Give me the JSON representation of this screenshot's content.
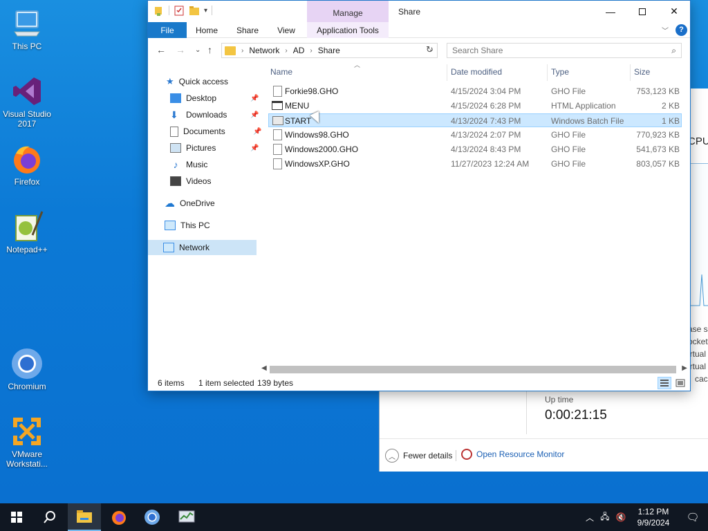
{
  "desktop": {
    "icons": [
      {
        "label": "This PC"
      },
      {
        "label": "Visual Studio 2017"
      },
      {
        "label": "Firefox"
      },
      {
        "label": "Notepad++"
      },
      {
        "label": "Chromium"
      },
      {
        "label": "VMware Workstati..."
      }
    ]
  },
  "task_manager": {
    "cpu_label": "CPU",
    "side_text": [
      "ase sp",
      "ocket",
      "irtual",
      "irtual",
      "cach"
    ],
    "uptime_label": "Up time",
    "uptime_value": "0:00:21:15",
    "fewer_details": "Fewer details",
    "open_resource_monitor": "Open Resource Monitor"
  },
  "explorer": {
    "contextual_tab": "Manage",
    "title": "Share",
    "ribbon_tabs": [
      "File",
      "Home",
      "Share",
      "View",
      "Application Tools"
    ],
    "help": "?",
    "address": {
      "parts": [
        "Network",
        "AD",
        "Share"
      ]
    },
    "search_placeholder": "Search Share",
    "nav": {
      "quick_access": "Quick access",
      "desktop": "Desktop",
      "downloads": "Downloads",
      "documents": "Documents",
      "pictures": "Pictures",
      "music": "Music",
      "videos": "Videos",
      "onedrive": "OneDrive",
      "this_pc": "This PC",
      "network": "Network"
    },
    "columns": {
      "name": "Name",
      "date": "Date modified",
      "type": "Type",
      "size": "Size"
    },
    "files": [
      {
        "name": "Forkie98.GHO",
        "date": "4/15/2024 3:04 PM",
        "type": "GHO File",
        "size": "753,123 KB"
      },
      {
        "name": "MENU",
        "date": "4/15/2024 6:28 PM",
        "type": "HTML Application",
        "size": "2 KB"
      },
      {
        "name": "START",
        "date": "4/13/2024 7:43 PM",
        "type": "Windows Batch File",
        "size": "1 KB"
      },
      {
        "name": "Windows98.GHO",
        "date": "4/13/2024 2:07 PM",
        "type": "GHO File",
        "size": "770,923 KB"
      },
      {
        "name": "Windows2000.GHO",
        "date": "4/13/2024 8:43 PM",
        "type": "GHO File",
        "size": "541,673 KB"
      },
      {
        "name": "WindowsXP.GHO",
        "date": "11/27/2023 12:24 AM",
        "type": "GHO File",
        "size": "803,057 KB"
      }
    ],
    "status": {
      "items": "6 items",
      "selected": "1 item selected",
      "bytes": "139 bytes"
    }
  },
  "taskbar": {
    "time": "1:12 PM",
    "date": "9/9/2024"
  }
}
